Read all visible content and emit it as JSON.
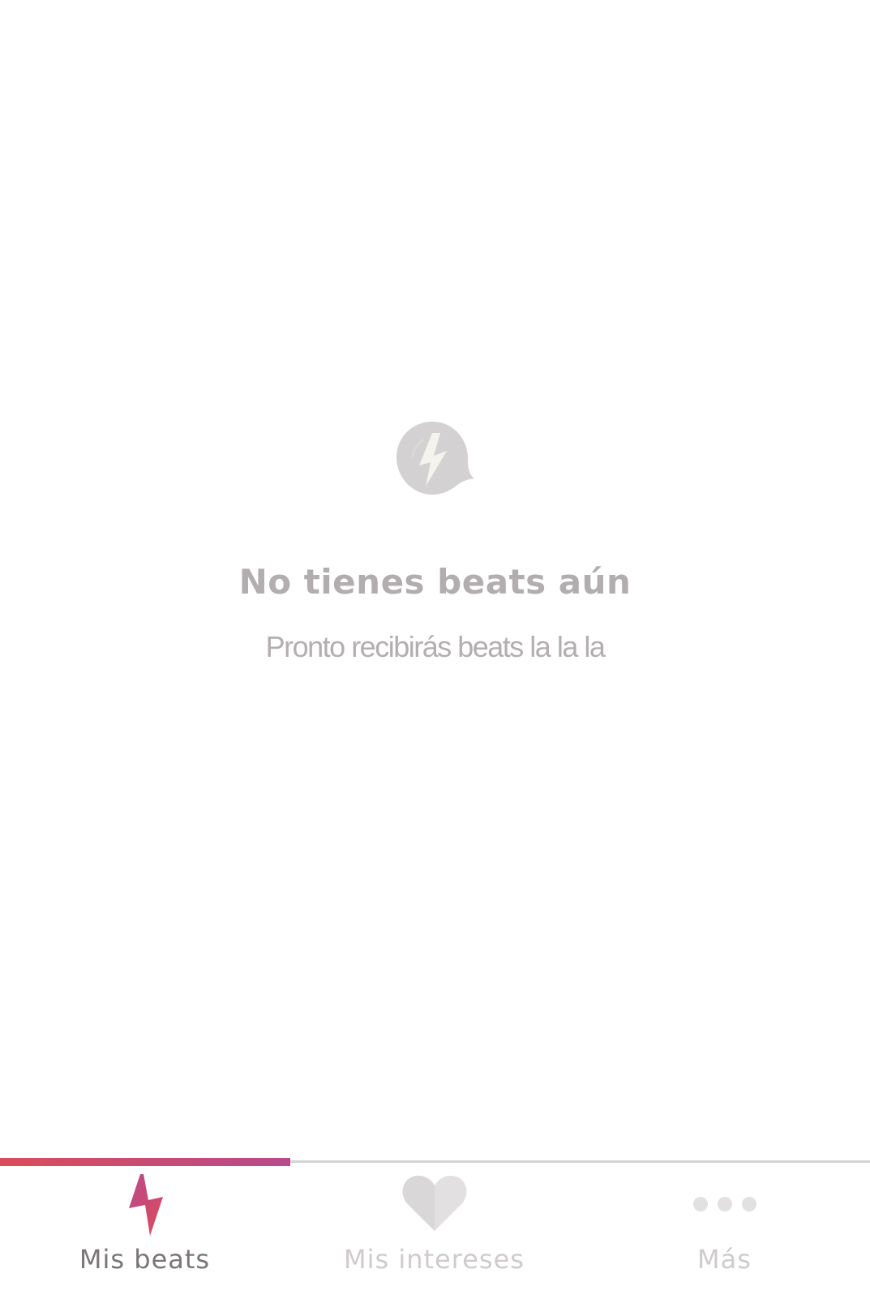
{
  "empty_state": {
    "icon": "beat-bubble-icon",
    "title": "No tienes beats aún",
    "subtitle": "Pronto recibirás beats la la la"
  },
  "tabbar": {
    "active_index": 0,
    "tabs": [
      {
        "label": "Mis beats",
        "icon": "lightning-icon",
        "active": true
      },
      {
        "label": "Mis intereses",
        "icon": "heart-icon",
        "active": false
      },
      {
        "label": "Más",
        "icon": "more-dots-icon",
        "active": false
      }
    ]
  },
  "colors": {
    "accent_start": "#dd4b5a",
    "accent_end": "#b84a8c",
    "muted_text": "#b2adae",
    "inactive_icon": "#e2e0e1"
  }
}
